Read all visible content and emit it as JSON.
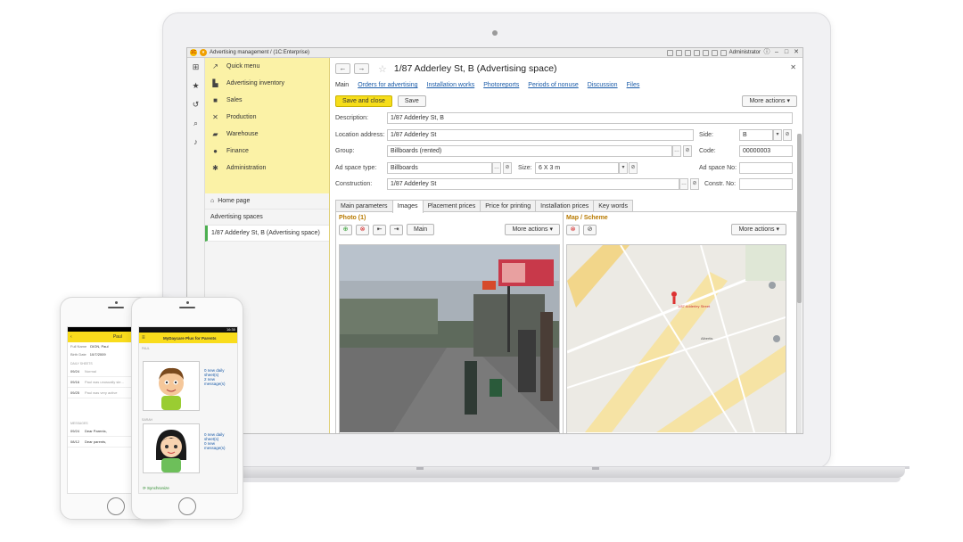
{
  "window": {
    "logo": "1C",
    "title": "Advertising management /  (1C:Enterprise)",
    "user": "Administrator"
  },
  "sections": {
    "items": [
      {
        "label": "Quick menu",
        "icon": "quick-menu-icon",
        "glyph": "↗"
      },
      {
        "label": "Advertising inventory",
        "icon": "bar-chart-icon",
        "glyph": "▙"
      },
      {
        "label": "Sales",
        "icon": "bag-icon",
        "glyph": "■"
      },
      {
        "label": "Production",
        "icon": "tools-icon",
        "glyph": "✕"
      },
      {
        "label": "Warehouse",
        "icon": "truck-icon",
        "glyph": "▰"
      },
      {
        "label": "Finance",
        "icon": "coin-icon",
        "glyph": "●"
      },
      {
        "label": "Administration",
        "icon": "gear-icon",
        "glyph": "✱"
      }
    ]
  },
  "nav": {
    "home": "Home page",
    "list": "Advertising spaces",
    "current": "1/87 Adderley St, B (Advertising space)"
  },
  "form": {
    "title": "1/87 Adderley St, B (Advertising space)",
    "links": [
      "Main",
      "Orders for advertising",
      "Installation works",
      "Photoreports",
      "Periods of nonuse",
      "Discussion",
      "Files"
    ],
    "save_close": "Save and close",
    "save": "Save",
    "more_actions": "More actions ▾",
    "fields": {
      "description_label": "Description:",
      "description": "1/87 Adderley St, B",
      "location_label": "Location address:",
      "location": "1/87 Adderley St",
      "side_label": "Side:",
      "side": "B",
      "group_label": "Group:",
      "group": "Billboards (rented)",
      "code_label": "Code:",
      "code": "00000003",
      "adtype_label": "Ad space type:",
      "adtype": "Billboards",
      "size_label": "Size:",
      "size": "6 X 3 m",
      "adno_label": "Ad space No:",
      "adno": "",
      "construction_label": "Construction:",
      "construction": "1/87 Adderley St",
      "constrno_label": "Constr. No:",
      "constrno": ""
    },
    "tabs": [
      "Main parameters",
      "Images",
      "Placement prices",
      "Price for printing",
      "Installation prices",
      "Key words"
    ],
    "photo_title": "Photo (1)",
    "map_title": "Map / Scheme",
    "main_btn": "Main",
    "map_labels": [
      "1/87 Adderley Street",
      "Albertis"
    ]
  },
  "phone1": {
    "time": "",
    "header": "Paul",
    "back": "‹",
    "full_name_label": "Full Name",
    "full_name": "DION, Paul",
    "birth_label": "Birth Date",
    "birth": "10/7/2009",
    "daily_label": "DAILY SHEETS",
    "sheets": [
      {
        "date": "09/24",
        "text": "Normal"
      },
      {
        "date": "09/16",
        "text": "Paul was unusually sle..."
      },
      {
        "date": "09/25",
        "text": "Paul was very active"
      }
    ],
    "messages_label": "MESSAGES",
    "messages": [
      {
        "date": "09/24",
        "text": "Dear Parents,"
      },
      {
        "date": "08/12",
        "text": "Dear parents,"
      }
    ]
  },
  "phone2": {
    "time": "16:30",
    "header": "MyDaycare Plus for Parents",
    "kids": [
      {
        "name": "PAUL",
        "line1": "0 new daily",
        "line2": "sheet(s)",
        "line3": "2 new",
        "line4": "message(s)"
      },
      {
        "name": "SARAH",
        "line1": "0 new daily",
        "line2": "sheet(s)",
        "line3": "0 new",
        "line4": "message(s)"
      }
    ],
    "sync": "Synchronize"
  }
}
